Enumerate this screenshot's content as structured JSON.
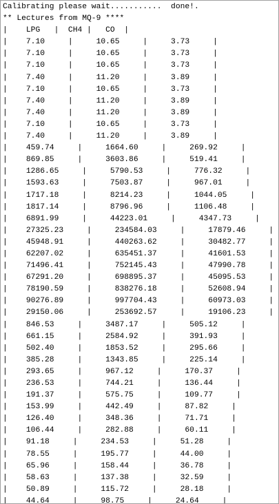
{
  "serial_monitor": {
    "lines": [
      "Calibrating please wait...........  done!.",
      "** Lectures from MQ-9 ****",
      "|    LPG   |  CH4 |   CO  |",
      "|    7.10     |     10.65     |     3.73     |",
      "|    7.10     |     10.65     |     3.73     |",
      "|    7.10     |     10.65     |     3.73     |",
      "|    7.40     |     11.20     |     3.89     |",
      "|    7.10     |     10.65     |     3.73     |",
      "|    7.40     |     11.20     |     3.89     |",
      "|    7.40     |     11.20     |     3.89     |",
      "|    7.10     |     10.65     |     3.73     |",
      "|    7.40     |     11.20     |     3.89     |",
      "|    459.74     |     1664.60     |     269.92     |",
      "|    869.85     |     3603.86     |     519.41     |",
      "|    1286.65     |     5790.53     |     776.32     |",
      "|    1593.63     |     7503.87     |     967.01     |",
      "|    1717.18     |     8214.23     |     1044.05     |",
      "|    1817.14     |     8796.96     |     1106.48     |",
      "|    6891.99     |     44223.01     |     4347.73     |",
      "|    27325.23     |     234584.03     |     17879.46     |",
      "|    45948.91     |     440263.62     |     30482.77     |",
      "|    62207.02     |     635451.37     |     41601.53     |",
      "|    71496.41     |     752145.43     |     47990.78     |",
      "|    67291.20     |     698895.37     |     45095.53     |",
      "|    78190.59     |     838276.18     |     52608.94     |",
      "|    90276.89     |     997704.43     |     60973.03     |",
      "|    29150.06     |     253692.57     |     19106.23     |",
      "|    846.53     |     3487.17     |     505.12     |",
      "|    661.15     |     2584.92     |     391.93     |",
      "|    502.40     |     1853.52     |     295.66     |",
      "|    385.28     |     1343.85     |     225.14     |",
      "|    293.65     |     967.12     |     170.37     |",
      "|    236.53     |     744.21     |     136.44     |",
      "|    191.37     |     575.75     |     109.77     |",
      "|    153.99     |     442.49     |     87.82     |",
      "|    126.40     |     348.36     |     71.71     |",
      "|    106.44     |     282.88     |     60.11     |",
      "|    91.18     |     234.53     |     51.28     |",
      "|    78.55     |     195.77     |     44.00     |",
      "|    65.96     |     158.44     |     36.78     |",
      "|    58.63     |     137.38     |     32.59     |",
      "|    50.89     |     115.72     |     28.18     |",
      "|    44.64     |     98.75     |     24.64     |"
    ]
  }
}
